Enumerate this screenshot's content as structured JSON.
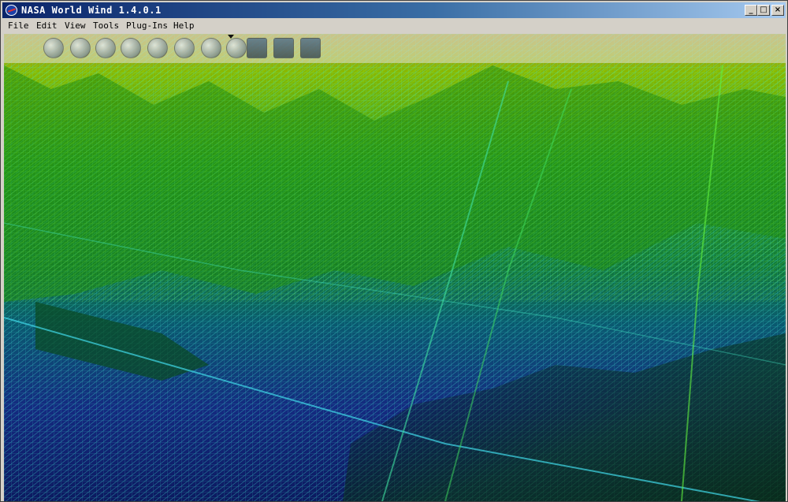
{
  "window": {
    "title": "NASA World Wind 1.4.0.1",
    "controls": {
      "minimize": "_",
      "maximize": "□",
      "close": "×"
    }
  },
  "menu": [
    "File",
    "Edit",
    "View",
    "Tools",
    "Plug-Ins",
    "Help"
  ],
  "toolbar": {
    "buttons": [
      "blue-marble-globe-icon",
      "landsat-globe-icon",
      "grid-lines-icon",
      "globe-icon",
      "clock-icon",
      "magnifier-search-icon",
      "globe-layer-icon",
      "globe-dropdown-icon",
      "map-layer-icon",
      "satellite-image-icon",
      "terrain-map-icon"
    ]
  },
  "view": {
    "mode": "wireframe terrain",
    "colors": {
      "low": "#1a2a8a",
      "mid": "#00c8d8",
      "high": "#7ed000",
      "peak": "#c8b000"
    }
  }
}
